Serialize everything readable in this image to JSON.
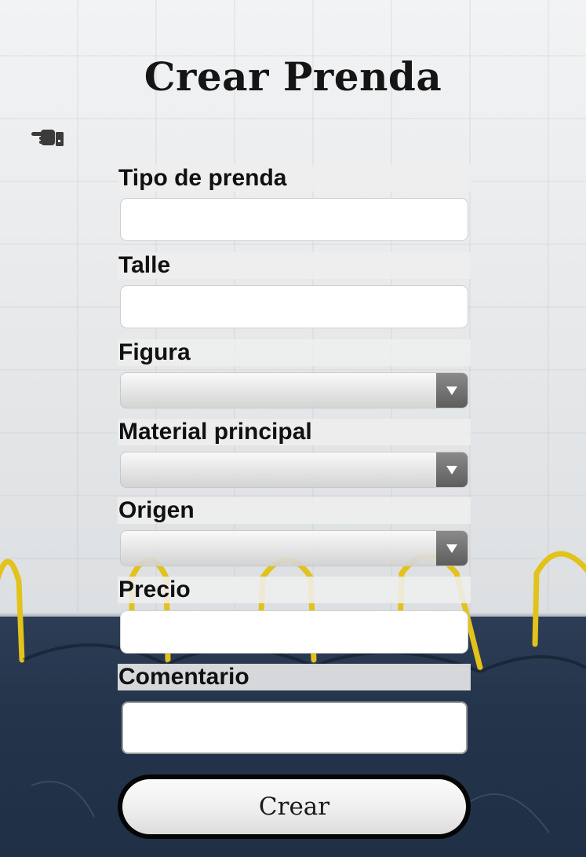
{
  "header": {
    "title": "Crear Prenda",
    "back_icon": "pointing-hand-icon"
  },
  "form": {
    "tipo_label": "Tipo de prenda",
    "tipo_value": "",
    "talle_label": "Talle",
    "talle_value": "",
    "figura_label": "Figura",
    "figura_selected": "",
    "material_label": "Material principal",
    "material_selected": "",
    "origen_label": "Origen",
    "origen_selected": "",
    "precio_label": "Precio",
    "precio_value": "",
    "comentario_label": "Comentario",
    "comentario_value": "",
    "submit_label": "Crear"
  },
  "colors": {
    "title_text": "#151515",
    "label_background": "#eeeeee",
    "select_arrow_background": "#6e6e6e",
    "button_border": "#050505",
    "ground": "#24344b",
    "bike_rack": "#e2c21b"
  }
}
